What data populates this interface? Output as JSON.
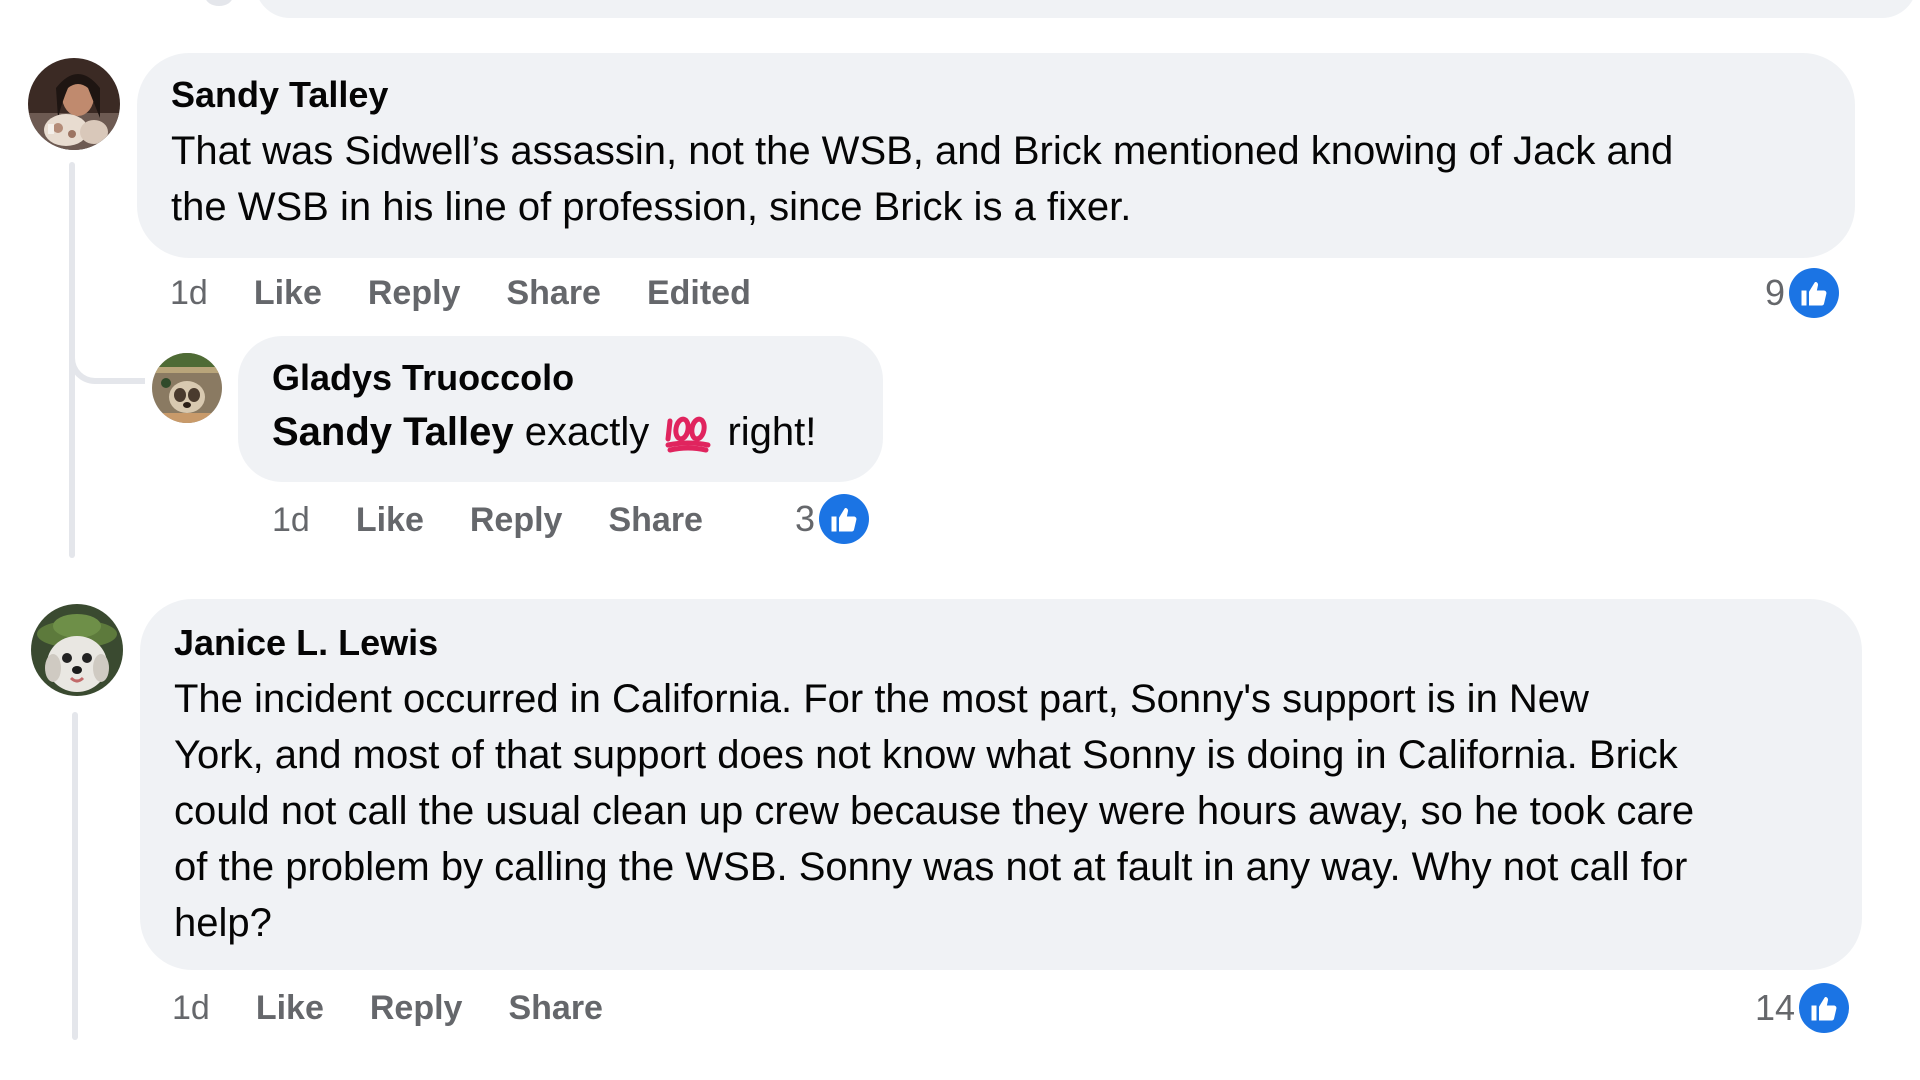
{
  "comments": [
    {
      "author": "Sandy Talley",
      "text_line1": "That was Sidwell’s assassin, not the WSB, and Brick mentioned knowing of Jack and",
      "text_line2": "the WSB in his line of profession, since Brick is a fixer.",
      "time": "1d",
      "like_label": "Like",
      "reply_label": "Reply",
      "share_label": "Share",
      "edited_label": "Edited",
      "reaction_count": "9"
    },
    {
      "author": "Gladys Truoccolo",
      "mention": "Sandy Talley",
      "text_before_emoji": "exactly",
      "emoji": "100",
      "text_after_emoji": "right!",
      "time": "1d",
      "like_label": "Like",
      "reply_label": "Reply",
      "share_label": "Share",
      "reaction_count": "3"
    },
    {
      "author": "Janice L. Lewis",
      "text_line1": "The incident occurred in California. For the most part, Sonny's support is in New",
      "text_line2": "York, and most of that support does not know what Sonny is doing in California. Brick",
      "text_line3": "could not call the usual clean up crew because they were hours away, so he took care",
      "text_line4": "of the problem by calling the WSB. Sonny was not at fault in any way. Why not call for",
      "text_line5": "help?",
      "time": "1d",
      "like_label": "Like",
      "reply_label": "Reply",
      "share_label": "Share",
      "reaction_count": "14"
    }
  ],
  "icons": {
    "reaction": "thumbs-up-icon",
    "emoji": "hundred-points-emoji"
  },
  "colors": {
    "bubble_bg": "#f0f2f5",
    "meta_text": "#65676b",
    "like_blue": "#1b74e4",
    "hundred_red": "#e0245e"
  }
}
